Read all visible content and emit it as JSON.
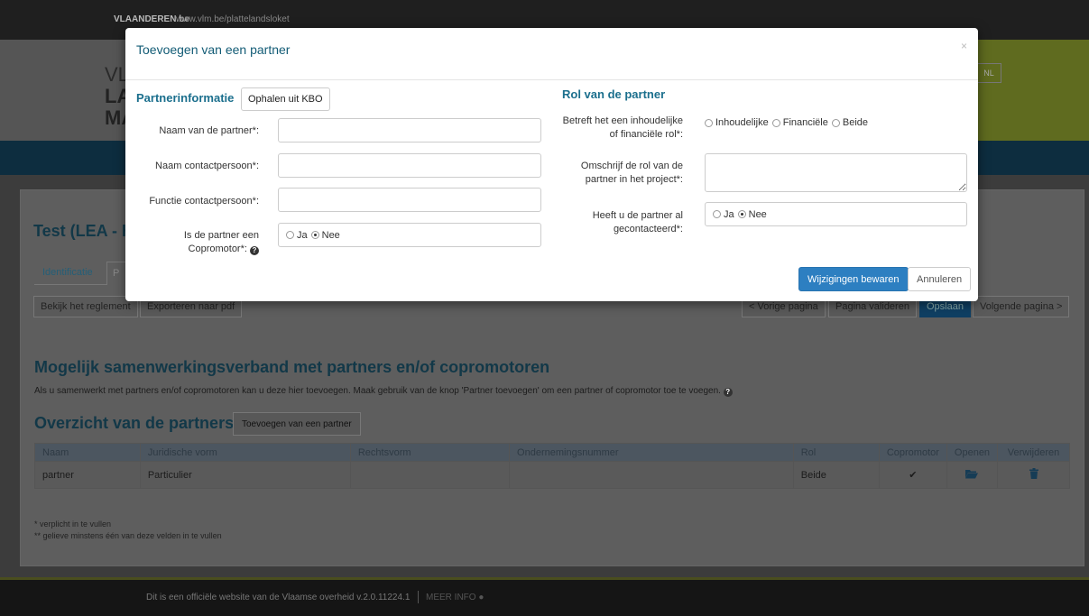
{
  "site": {
    "brand": "VLAANDEREN.be",
    "url": "www.vlm.be/plattelandsloket",
    "lang": "NL",
    "logo_line1": "VL",
    "logo_line2": "LA",
    "logo_line3": "MA"
  },
  "page": {
    "title": "Test (LEA - H",
    "tabs": [
      {
        "label": "Identificatie"
      },
      {
        "label": "P"
      }
    ],
    "toolbar": {
      "regulation": "Bekijk het reglement",
      "export_pdf": "Exporteren naar pdf",
      "prev_page": "< Vorige pagina",
      "validate_page": "Pagina valideren",
      "save": "Opslaan",
      "next_page": "Volgende pagina >"
    },
    "section_title": "Mogelijk samenwerkingsverband met partners en/of copromotoren",
    "section_text": "Als u samenwerkt met partners en/of copromotoren kan u deze hier toevoegen. Maak gebruik van de knop 'Partner toevoegen' om een partner of copromotor toe te voegen.",
    "overview_title": "Overzicht van de partners",
    "add_partner_label": "Toevoegen van een partner",
    "table": {
      "headers": [
        "Naam",
        "Juridische vorm",
        "Rechtsvorm",
        "Ondernemingsnummer",
        "Rol",
        "Copromotor",
        "Openen",
        "Verwijderen"
      ],
      "rows": [
        {
          "naam": "partner",
          "juridische_vorm": "Particulier",
          "rechtsvorm": "",
          "ondernemingsnummer": "",
          "rol": "Beide",
          "copromotor": "✔",
          "openen": "folder-open-icon",
          "verwijderen": "trash-icon"
        }
      ]
    },
    "note1": "* verplicht in te vullen",
    "note2": "** gelieve minstens één van deze velden in te vullen",
    "footer_text": "Dit is een officiële website van de Vlaamse overheid v.2.0.11224.1",
    "footer_more": "MEER INFO"
  },
  "modal": {
    "title": "Toevoegen van een partner",
    "close": "×",
    "left": {
      "title": "Partnerinformatie",
      "kbo_button": "Ophalen uit KBO",
      "fields": [
        {
          "label": "Naam van de partner*:",
          "value": ""
        },
        {
          "label": "Naam contactpersoon*:",
          "value": ""
        },
        {
          "label": "Functie contactpersoon*:",
          "value": ""
        }
      ],
      "copromotor_label_1": "Is de partner een",
      "copromotor_label_2": "Copromotor*:",
      "copromotor_options": [
        "Ja",
        "Nee"
      ],
      "copromotor_selected": "Nee"
    },
    "right": {
      "title": "Rol van de partner",
      "role_label_1": "Betreft het een inhoudelijke",
      "role_label_2": "of financiële rol*:",
      "role_options": [
        "Inhoudelijke",
        "Financiële",
        "Beide"
      ],
      "describe_label_1": "Omschrijf de rol van de",
      "describe_label_2": "partner in het project*:",
      "describe_value": "",
      "contacted_label_1": "Heeft u de partner al",
      "contacted_label_2": "gecontacteerd*:",
      "contacted_options": [
        "Ja",
        "Nee"
      ],
      "contacted_selected": "Nee"
    },
    "save_button": "Wijzigingen bewaren",
    "cancel_button": "Annuleren"
  },
  "colors": {
    "accent": "#135c76",
    "primary_button": "#2d7fc1",
    "overlay_nav": "#0d2d3f",
    "brand_green": "#5f6b1f"
  }
}
